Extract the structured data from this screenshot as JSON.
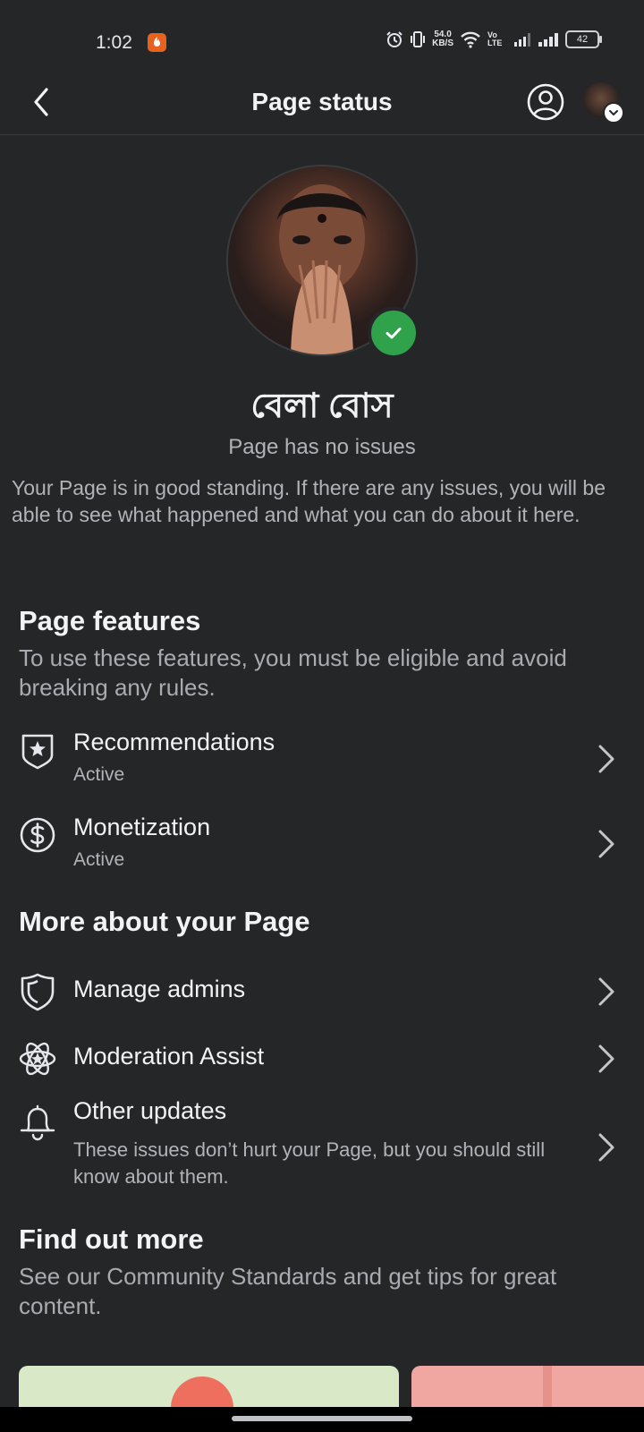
{
  "status_bar": {
    "time": "1:02",
    "net_speed_value": "54.0",
    "net_speed_unit": "KB/S",
    "network_label": "Vo LTE",
    "battery": "42"
  },
  "header": {
    "title": "Page status",
    "back_icon": "back-arrow-icon",
    "account_icon": "account-circle-icon"
  },
  "profile": {
    "name": "বেলা বোস",
    "status": "Page has no issues",
    "description": "Your Page is in good standing. If there are any issues, you will be able to see what happened and what you can do about it here.",
    "badge_color": "#31a24c"
  },
  "page_features": {
    "title": "Page features",
    "subtitle": "To use these features, you must be eligible and avoid breaking any rules.",
    "items": [
      {
        "label": "Recommendations",
        "status": "Active",
        "icon": "shield-star-icon"
      },
      {
        "label": "Monetization",
        "status": "Active",
        "icon": "dollar-circle-icon"
      }
    ]
  },
  "more_about": {
    "title": "More about your Page",
    "items": [
      {
        "label": "Manage admins",
        "icon": "shield-icon"
      },
      {
        "label": "Moderation Assist",
        "icon": "atom-star-icon"
      },
      {
        "label": "Other updates",
        "description": "These issues don’t hurt your Page, but you should still know about them.",
        "icon": "bell-icon"
      }
    ]
  },
  "find_out_more": {
    "title": "Find out more",
    "subtitle": "See our Community Standards and get tips for great content."
  },
  "theme": {
    "background": "#252628",
    "text_primary": "#f2f3f5",
    "text_secondary": "#b0b3b8"
  }
}
